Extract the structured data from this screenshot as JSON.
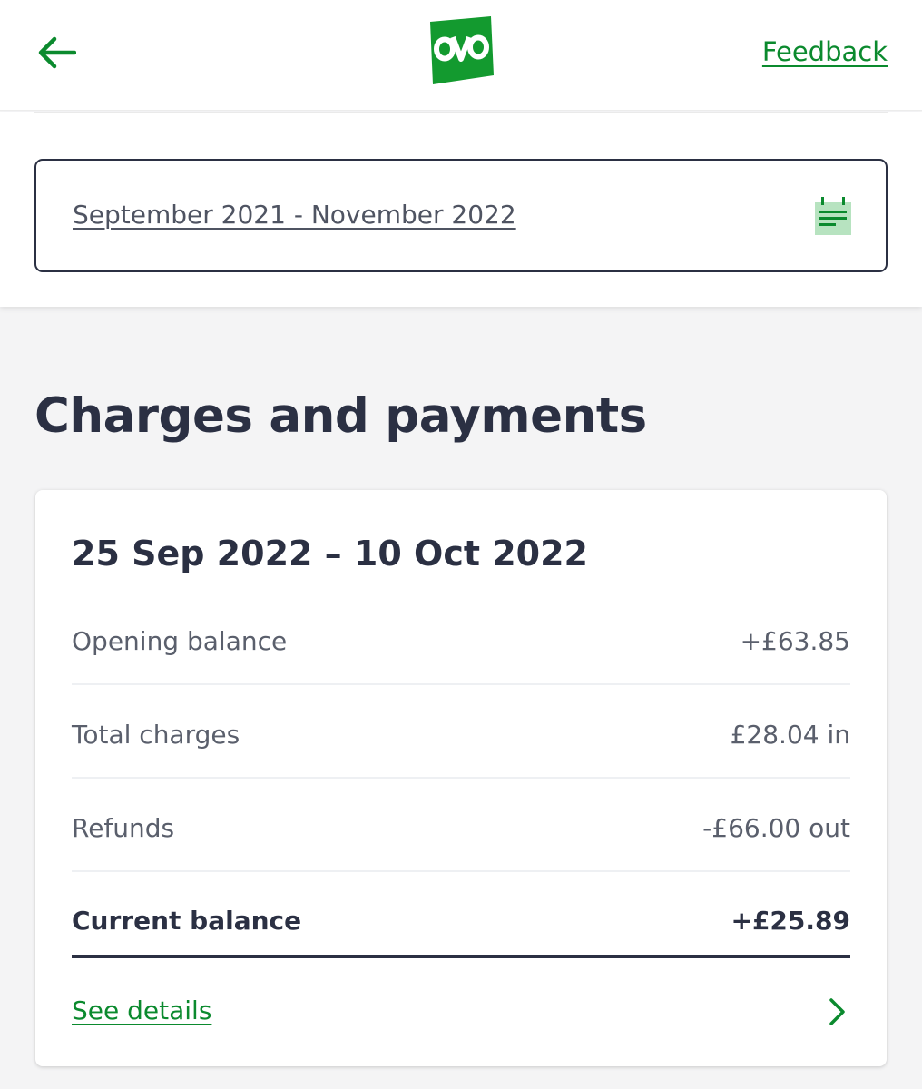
{
  "header": {
    "back_icon": "arrow-left-icon",
    "logo_text": "ovo",
    "feedback_label": "Feedback"
  },
  "date_filter": {
    "range": "September 2021 - November 2022",
    "icon": "calendar-icon"
  },
  "section_title": "Charges and payments",
  "statement": {
    "period": "25 Sep 2022 – 10 Oct 2022",
    "rows": [
      {
        "label": "Opening balance",
        "value": "+£63.85"
      },
      {
        "label": "Total charges",
        "value": "£28.04 in"
      },
      {
        "label": "Refunds",
        "value": "-£66.00 out"
      }
    ],
    "total": {
      "label": "Current balance",
      "value": "+£25.89"
    },
    "details_label": "See details",
    "details_icon": "chevron-right-icon"
  },
  "colors": {
    "brand_green": "#0b8a2e",
    "logo_green": "#139a2f",
    "text_dark": "#2b3043",
    "text_muted": "#5a5f6c",
    "background": "#f4f4f5"
  }
}
